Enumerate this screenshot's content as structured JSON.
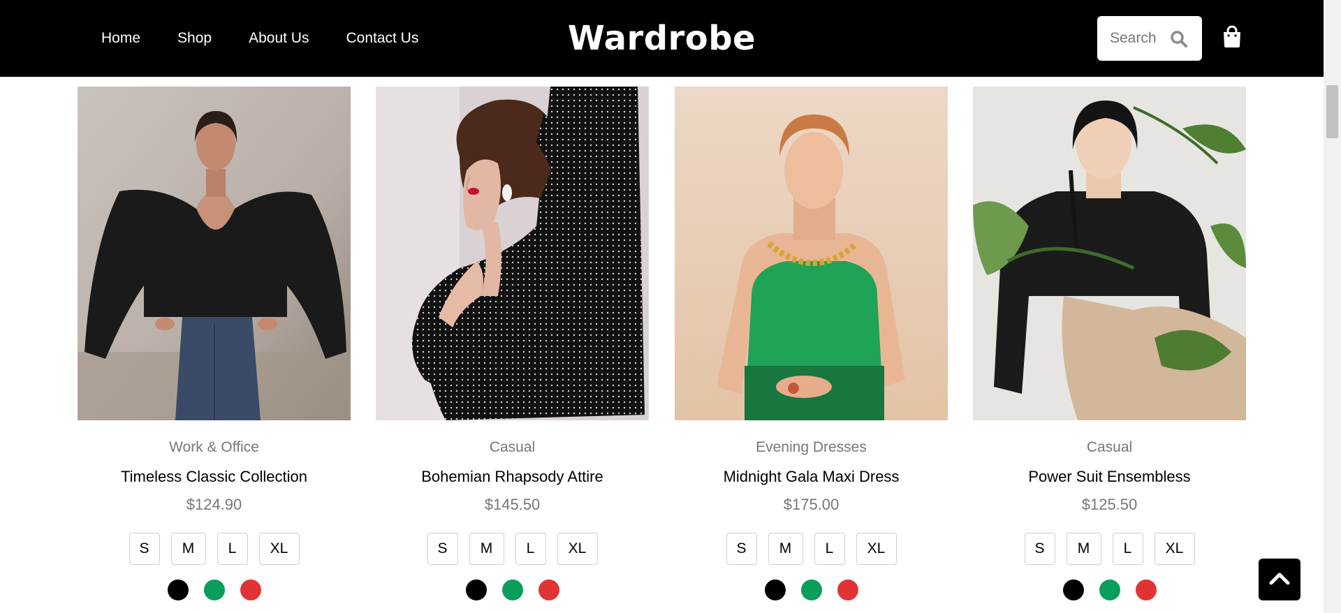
{
  "nav": {
    "items": [
      {
        "label": "Home"
      },
      {
        "label": "Shop"
      },
      {
        "label": "About Us"
      },
      {
        "label": "Contact Us"
      }
    ],
    "brand": "Wardrobe",
    "search_placeholder": "Search",
    "icons": {
      "search": "search-icon",
      "cart": "shopping-bag-icon",
      "scroll_top": "chevron-up-icon"
    }
  },
  "colors": {
    "header_bg": "#000000",
    "muted_text": "#777777",
    "swatch_black": "#000000",
    "swatch_green": "#0a9e5b",
    "swatch_red": "#e03434"
  },
  "products": [
    {
      "category": "Work & Office",
      "name": "Timeless Classic Collection",
      "price": "$124.90",
      "sizes": [
        "S",
        "M",
        "L",
        "XL"
      ],
      "colors": [
        "#000000",
        "#0a9e5b",
        "#e03434"
      ]
    },
    {
      "category": "Casual",
      "name": "Bohemian Rhapsody Attire",
      "price": "$145.50",
      "sizes": [
        "S",
        "M",
        "L",
        "XL"
      ],
      "colors": [
        "#000000",
        "#0a9e5b",
        "#e03434"
      ]
    },
    {
      "category": "Evening Dresses",
      "name": "Midnight Gala Maxi Dress",
      "price": "$175.00",
      "sizes": [
        "S",
        "M",
        "L",
        "XL"
      ],
      "colors": [
        "#000000",
        "#0a9e5b",
        "#e03434"
      ]
    },
    {
      "category": "Casual",
      "name": "Power Suit Ensembless",
      "price": "$125.50",
      "sizes": [
        "S",
        "M",
        "L",
        "XL"
      ],
      "colors": [
        "#000000",
        "#0a9e5b",
        "#e03434"
      ]
    }
  ]
}
